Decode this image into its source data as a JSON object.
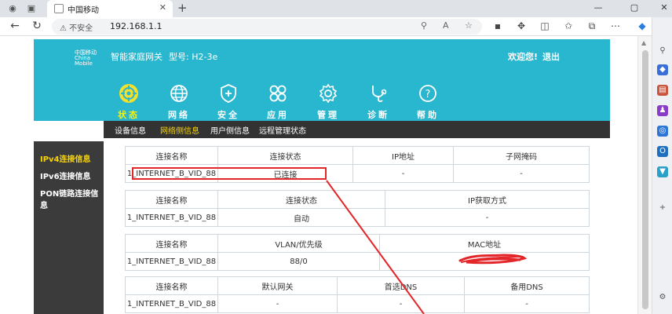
{
  "browser": {
    "tab_title": "中国移动",
    "address": "192.168.1.1",
    "security_label": "不安全"
  },
  "header": {
    "brand": "智能家庭网关",
    "model_label": "型号:",
    "model_value": "H2-3e",
    "welcome": "欢迎您!",
    "logout": "退出",
    "logo_cn": "中国移动",
    "logo_en": "China Mobile"
  },
  "menu": [
    {
      "label": "状态",
      "icon": "status-icon"
    },
    {
      "label": "网络",
      "icon": "globe-icon"
    },
    {
      "label": "安全",
      "icon": "shield-icon"
    },
    {
      "label": "应用",
      "icon": "apps-icon"
    },
    {
      "label": "管理",
      "icon": "gear-icon"
    },
    {
      "label": "诊断",
      "icon": "stethoscope-icon"
    },
    {
      "label": "帮助",
      "icon": "help-icon"
    }
  ],
  "subnav": [
    "设备信息",
    "网络侧信息",
    "用户侧信息",
    "远程管理状态"
  ],
  "leftnav": [
    "IPv4连接信息",
    "IPv6连接信息",
    "PON链路连接信息"
  ],
  "tables": [
    {
      "headers": [
        "连接名称",
        "连接状态",
        "IP地址",
        "子网掩码"
      ],
      "row": [
        "1_INTERNET_B_VID_88",
        "已连接",
        "-",
        "-"
      ]
    },
    {
      "headers": [
        "连接名称",
        "连接状态",
        "IP获取方式"
      ],
      "row": [
        "1_INTERNET_B_VID_88",
        "自动",
        "-"
      ]
    },
    {
      "headers": [
        "连接名称",
        "VLAN/优先级",
        "MAC地址"
      ],
      "row": [
        "1_INTERNET_B_VID_88",
        "88/0",
        ""
      ]
    },
    {
      "headers": [
        "连接名称",
        "默认网关",
        "首选DNS",
        "备用DNS"
      ],
      "row": [
        "1_INTERNET_B_VID_88",
        "-",
        "-",
        "-"
      ]
    }
  ],
  "colors": {
    "header_bg": "#29b6cf",
    "active_yellow": "#f5d20a",
    "annotation_red": "#e3262a"
  }
}
